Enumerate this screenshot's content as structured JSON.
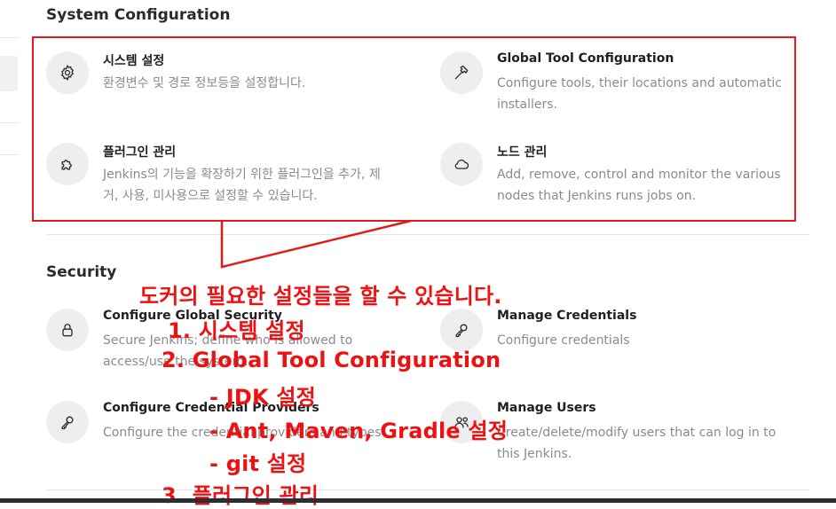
{
  "system_configuration": {
    "title": "System Configuration",
    "items": [
      {
        "title": "시스템 설정",
        "desc": "환경변수 및 경로 정보등을 설정합니다.",
        "icon": "gear-icon"
      },
      {
        "title": "Global Tool Configuration",
        "desc": "Configure tools, their locations and automatic installers.",
        "icon": "hammer-icon"
      },
      {
        "title": "플러그인 관리",
        "desc": "Jenkins의 기능을 확장하기 위한 플러그인을 추가, 제거, 사용, 미사용으로 설정할 수 있습니다.",
        "icon": "puzzle-icon"
      },
      {
        "title": "노드 관리",
        "desc": "Add, remove, control and monitor the various nodes that Jenkins runs jobs on.",
        "icon": "cloud-icon"
      }
    ]
  },
  "security": {
    "title": "Security",
    "items": [
      {
        "title": "Configure Global Security",
        "desc": "Secure Jenkins; define who is allowed to access/use the system.",
        "icon": "lock-icon"
      },
      {
        "title": "Manage Credentials",
        "desc": "Configure credentials",
        "icon": "key-icon"
      },
      {
        "title": "Configure Credential Providers",
        "desc": "Configure the credential providers and types",
        "icon": "key-icon"
      },
      {
        "title": "Manage Users",
        "desc": "Create/delete/modify users that can log in to this Jenkins.",
        "icon": "users-icon"
      }
    ]
  },
  "annotation": {
    "headline": "도커의 필요한 설정들을 할 수 있습니다.",
    "line1": "1. 시스템 설정",
    "line2": "2. Global Tool Configuration",
    "line3": "- JDK 설정",
    "line4": "- Ant, Maven, Gradle 설정",
    "line5": "- git 설정",
    "line6": "3. 플러그인 관리",
    "color": "#ee1111"
  }
}
